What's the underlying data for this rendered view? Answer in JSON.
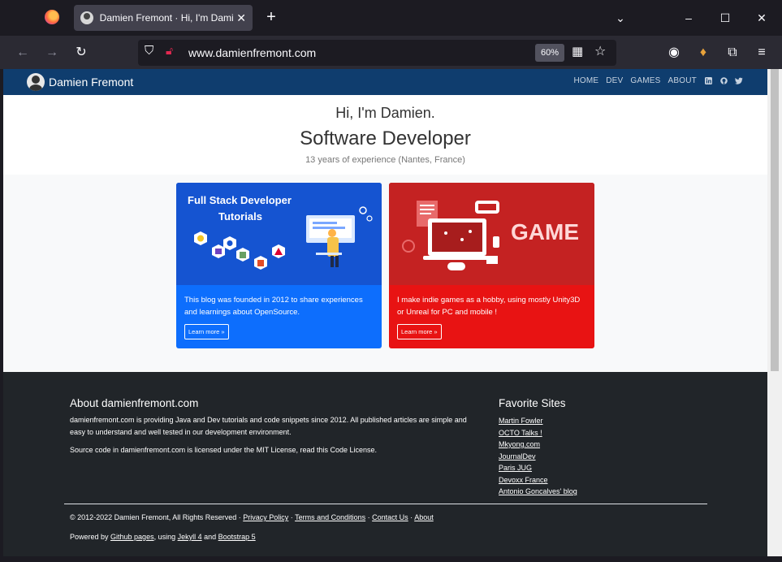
{
  "browser": {
    "tab_title": "Damien Fremont · Hi, I'm Dami",
    "url": "www.damienfremont.com",
    "zoom": "60%"
  },
  "site": {
    "brand": "Damien Fremont",
    "menu": [
      "HOME",
      "DEV",
      "GAMES",
      "ABOUT"
    ],
    "social_icons": [
      "linkedin-icon",
      "github-icon",
      "twitter-icon"
    ]
  },
  "hero": {
    "greeting": "Hi, I'm Damien.",
    "role": "Software Developer",
    "experience": "13 years of experience (Nantes, France)"
  },
  "cards": {
    "blog": {
      "image_title": "Full Stack Developer Tutorials",
      "desc": "This blog was founded in 2012 to share experiences and learnings about OpenSource.",
      "button": "Learn more »"
    },
    "game": {
      "image_title": "GAME",
      "desc": "I make indie games as a hobby, using mostly Unity3D or Unreal for PC and mobile !",
      "button": "Learn more »"
    }
  },
  "footer": {
    "about_title": "About damienfremont.com",
    "about_text1": "damienfremont.com is providing Java and Dev tutorials and code snippets since 2012. All published articles are simple and easy to understand and well tested in our development environment.",
    "about_text2": "Source code in damienfremont.com is licensed under the MIT License, read this Code License.",
    "favorites_title": "Favorite Sites",
    "favorites": [
      "Martin Fowler",
      "OCTO Talks !",
      "Mkyong.com",
      "JournalDev",
      "Paris JUG",
      "Devoxx France",
      "Antonio Goncalves' blog"
    ],
    "copyright_prefix": "© 2012-2022 Damien Fremont, All Rights Reserved · ",
    "privacy": "Privacy Policy",
    "terms": "Terms and Conditions",
    "contact": "Contact Us",
    "about": "About",
    "powered_prefix": "Powered by ",
    "github_pages": "Github pages",
    "using": ", using ",
    "jekyll": "Jekyll 4",
    "and": " and ",
    "bootstrap": "Bootstrap 5"
  },
  "colors": {
    "site_header": "#0f3d6e",
    "blog_card": "#0d6efd",
    "game_card": "#e81313",
    "footer": "#212529"
  }
}
